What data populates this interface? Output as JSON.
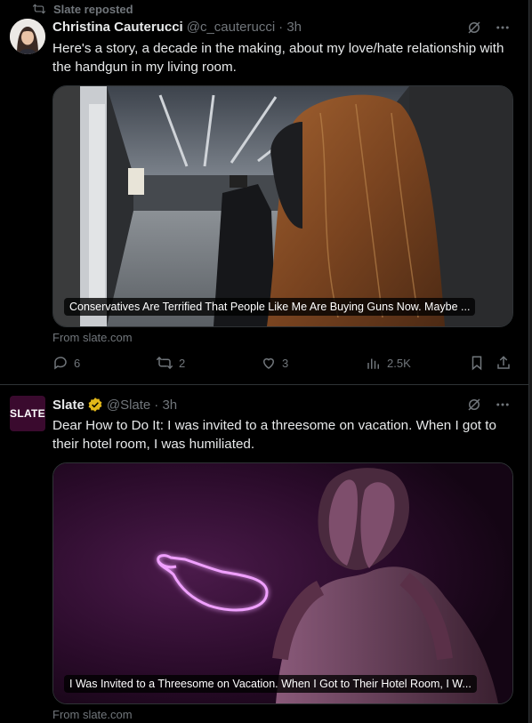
{
  "posts": [
    {
      "repost_label": "Slate reposted",
      "author": {
        "name": "Christina Cauterucci",
        "handle": "@c_cauterucci",
        "time": "· 3h"
      },
      "text": "Here's a story, a decade in the making, about my love/hate relationship with the handgun in my living room.",
      "card": {
        "title": "Conservatives Are Terrified That People Like Me Are Buying Guns Now. Maybe ...",
        "source": "From slate.com"
      },
      "actions": {
        "replies": "6",
        "reposts": "2",
        "likes": "3",
        "views": "2.5K"
      }
    },
    {
      "author": {
        "name": "Slate",
        "handle": "@Slate",
        "time": "· 3h",
        "avatar_text": "SLATE",
        "verified": true
      },
      "text": "Dear How to Do It: I was invited to a threesome on vacation. When I got to their hotel room, I was humiliated.",
      "card": {
        "title": "I Was Invited to a Threesome on Vacation. When I Got to Their Hotel Room, I W...",
        "source": "From slate.com"
      }
    }
  ],
  "icons": [
    "repost-icon",
    "grok-icon",
    "more-icon",
    "reply-icon",
    "like-icon",
    "views-icon",
    "bookmark-icon",
    "share-icon",
    "verified-badge-icon"
  ],
  "colors": {
    "background": "#000000",
    "text": "#e7e9ea",
    "muted": "#71767b",
    "border": "#2f3336",
    "verified": "#e2b719",
    "neon": "#e070ff"
  }
}
